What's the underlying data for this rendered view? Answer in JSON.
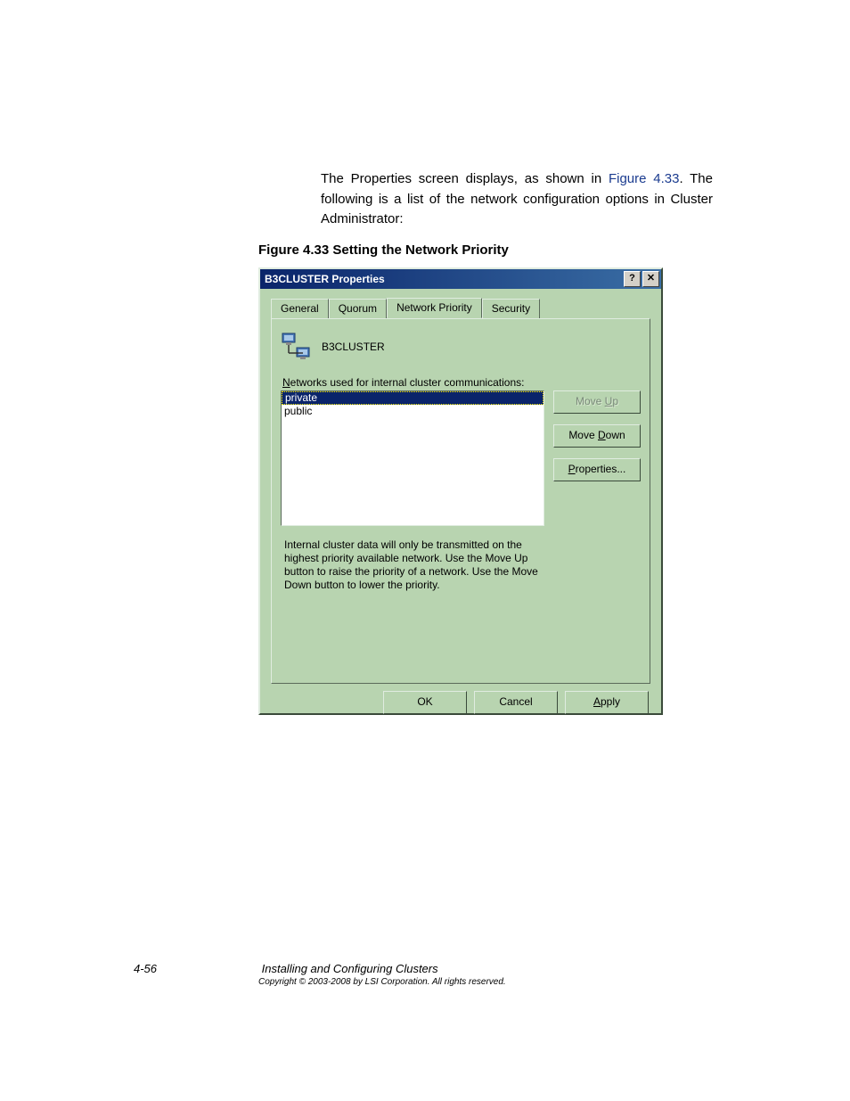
{
  "intro": {
    "prefix": "The Properties screen displays, as shown in ",
    "figref": "Figure 4.33",
    "suffix": ". The following is a list of the network configuration options in Cluster Administrator:"
  },
  "figure_caption": "Figure 4.33  Setting the Network Priority",
  "dialog": {
    "title": "B3CLUSTER Properties",
    "help_glyph": "?",
    "close_glyph": "✕",
    "tabs": {
      "general": "General",
      "quorum": "Quorum",
      "network_priority": "Network Priority",
      "security": "Security"
    },
    "cluster_name": "B3CLUSTER",
    "list_label_underline": "N",
    "list_label_rest": "etworks used for internal cluster communications:",
    "networks": {
      "item0": "private",
      "item1": "public"
    },
    "buttons": {
      "move_up_pre": "Move ",
      "move_up_ul": "U",
      "move_up_post": "p",
      "move_down_pre": "Move ",
      "move_down_ul": "D",
      "move_down_post": "own",
      "properties_ul": "P",
      "properties_post": "roperties...",
      "ok": "OK",
      "cancel": "Cancel",
      "apply_ul": "A",
      "apply_post": "pply"
    },
    "description": "Internal cluster data will only be transmitted on the highest priority available network. Use the Move Up button to raise the priority of a network. Use the Move Down button to lower the priority."
  },
  "footer": {
    "page_number": "4-56",
    "title": "Installing and Configuring Clusters",
    "copyright": "Copyright © 2003-2008 by LSI Corporation. All rights reserved."
  }
}
